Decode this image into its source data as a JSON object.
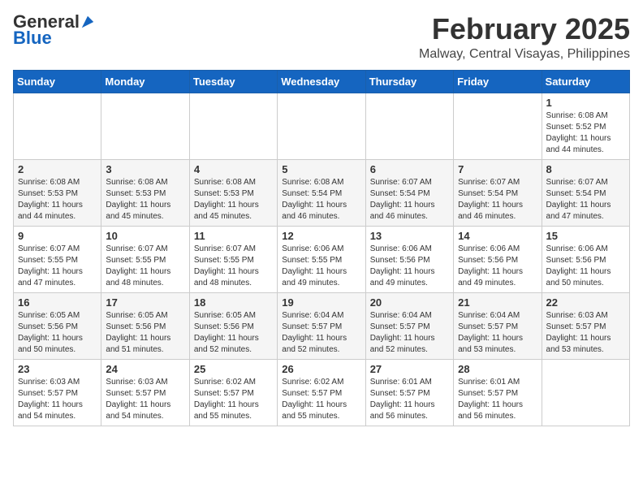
{
  "header": {
    "logo_general": "General",
    "logo_blue": "Blue",
    "month": "February 2025",
    "location": "Malway, Central Visayas, Philippines"
  },
  "days_of_week": [
    "Sunday",
    "Monday",
    "Tuesday",
    "Wednesday",
    "Thursday",
    "Friday",
    "Saturday"
  ],
  "weeks": [
    [
      {
        "day": "",
        "info": ""
      },
      {
        "day": "",
        "info": ""
      },
      {
        "day": "",
        "info": ""
      },
      {
        "day": "",
        "info": ""
      },
      {
        "day": "",
        "info": ""
      },
      {
        "day": "",
        "info": ""
      },
      {
        "day": "1",
        "info": "Sunrise: 6:08 AM\nSunset: 5:52 PM\nDaylight: 11 hours\nand 44 minutes."
      }
    ],
    [
      {
        "day": "2",
        "info": "Sunrise: 6:08 AM\nSunset: 5:53 PM\nDaylight: 11 hours\nand 44 minutes."
      },
      {
        "day": "3",
        "info": "Sunrise: 6:08 AM\nSunset: 5:53 PM\nDaylight: 11 hours\nand 45 minutes."
      },
      {
        "day": "4",
        "info": "Sunrise: 6:08 AM\nSunset: 5:53 PM\nDaylight: 11 hours\nand 45 minutes."
      },
      {
        "day": "5",
        "info": "Sunrise: 6:08 AM\nSunset: 5:54 PM\nDaylight: 11 hours\nand 46 minutes."
      },
      {
        "day": "6",
        "info": "Sunrise: 6:07 AM\nSunset: 5:54 PM\nDaylight: 11 hours\nand 46 minutes."
      },
      {
        "day": "7",
        "info": "Sunrise: 6:07 AM\nSunset: 5:54 PM\nDaylight: 11 hours\nand 46 minutes."
      },
      {
        "day": "8",
        "info": "Sunrise: 6:07 AM\nSunset: 5:54 PM\nDaylight: 11 hours\nand 47 minutes."
      }
    ],
    [
      {
        "day": "9",
        "info": "Sunrise: 6:07 AM\nSunset: 5:55 PM\nDaylight: 11 hours\nand 47 minutes."
      },
      {
        "day": "10",
        "info": "Sunrise: 6:07 AM\nSunset: 5:55 PM\nDaylight: 11 hours\nand 48 minutes."
      },
      {
        "day": "11",
        "info": "Sunrise: 6:07 AM\nSunset: 5:55 PM\nDaylight: 11 hours\nand 48 minutes."
      },
      {
        "day": "12",
        "info": "Sunrise: 6:06 AM\nSunset: 5:55 PM\nDaylight: 11 hours\nand 49 minutes."
      },
      {
        "day": "13",
        "info": "Sunrise: 6:06 AM\nSunset: 5:56 PM\nDaylight: 11 hours\nand 49 minutes."
      },
      {
        "day": "14",
        "info": "Sunrise: 6:06 AM\nSunset: 5:56 PM\nDaylight: 11 hours\nand 49 minutes."
      },
      {
        "day": "15",
        "info": "Sunrise: 6:06 AM\nSunset: 5:56 PM\nDaylight: 11 hours\nand 50 minutes."
      }
    ],
    [
      {
        "day": "16",
        "info": "Sunrise: 6:05 AM\nSunset: 5:56 PM\nDaylight: 11 hours\nand 50 minutes."
      },
      {
        "day": "17",
        "info": "Sunrise: 6:05 AM\nSunset: 5:56 PM\nDaylight: 11 hours\nand 51 minutes."
      },
      {
        "day": "18",
        "info": "Sunrise: 6:05 AM\nSunset: 5:56 PM\nDaylight: 11 hours\nand 52 minutes."
      },
      {
        "day": "19",
        "info": "Sunrise: 6:04 AM\nSunset: 5:57 PM\nDaylight: 11 hours\nand 52 minutes."
      },
      {
        "day": "20",
        "info": "Sunrise: 6:04 AM\nSunset: 5:57 PM\nDaylight: 11 hours\nand 52 minutes."
      },
      {
        "day": "21",
        "info": "Sunrise: 6:04 AM\nSunset: 5:57 PM\nDaylight: 11 hours\nand 53 minutes."
      },
      {
        "day": "22",
        "info": "Sunrise: 6:03 AM\nSunset: 5:57 PM\nDaylight: 11 hours\nand 53 minutes."
      }
    ],
    [
      {
        "day": "23",
        "info": "Sunrise: 6:03 AM\nSunset: 5:57 PM\nDaylight: 11 hours\nand 54 minutes."
      },
      {
        "day": "24",
        "info": "Sunrise: 6:03 AM\nSunset: 5:57 PM\nDaylight: 11 hours\nand 54 minutes."
      },
      {
        "day": "25",
        "info": "Sunrise: 6:02 AM\nSunset: 5:57 PM\nDaylight: 11 hours\nand 55 minutes."
      },
      {
        "day": "26",
        "info": "Sunrise: 6:02 AM\nSunset: 5:57 PM\nDaylight: 11 hours\nand 55 minutes."
      },
      {
        "day": "27",
        "info": "Sunrise: 6:01 AM\nSunset: 5:57 PM\nDaylight: 11 hours\nand 56 minutes."
      },
      {
        "day": "28",
        "info": "Sunrise: 6:01 AM\nSunset: 5:57 PM\nDaylight: 11 hours\nand 56 minutes."
      },
      {
        "day": "",
        "info": ""
      }
    ]
  ]
}
